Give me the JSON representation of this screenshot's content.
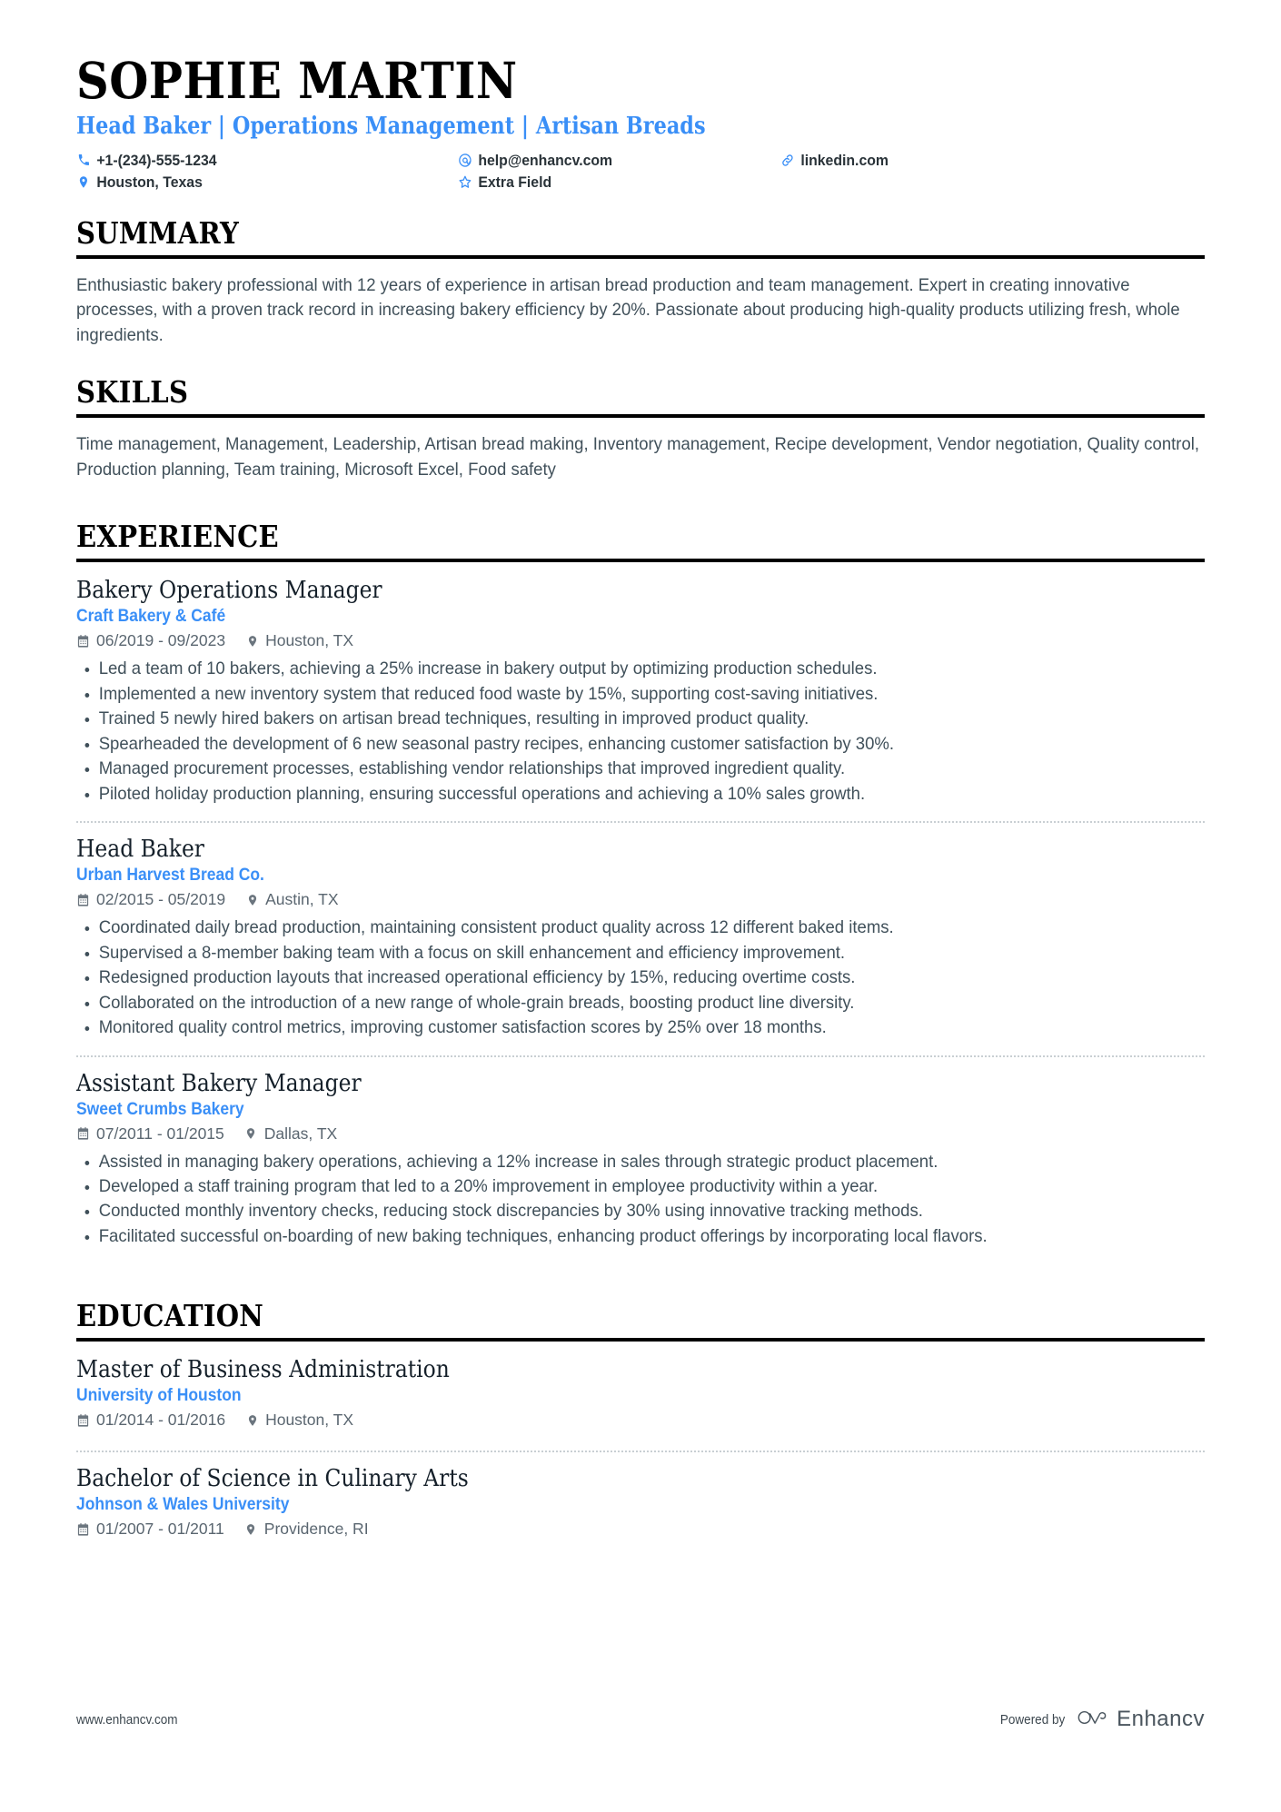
{
  "header": {
    "name": "SOPHIE MARTIN",
    "headline": "Head Baker | Operations Management | Artisan Breads",
    "contacts": [
      {
        "icon": "phone-icon",
        "text": "+1-(234)-555-1234"
      },
      {
        "icon": "email-icon",
        "text": "help@enhancv.com"
      },
      {
        "icon": "link-icon",
        "text": "linkedin.com"
      },
      {
        "icon": "location-icon",
        "text": "Houston, Texas"
      },
      {
        "icon": "star-icon",
        "text": "Extra Field"
      }
    ]
  },
  "summary": {
    "title": "SUMMARY",
    "text": "Enthusiastic bakery professional with 12 years of experience in artisan bread production and team management. Expert in creating innovative processes, with a proven track record in increasing bakery efficiency by 20%. Passionate about producing high-quality products utilizing fresh, whole ingredients."
  },
  "skills": {
    "title": "SKILLS",
    "text": "Time management, Management, Leadership, Artisan bread making, Inventory management, Recipe development, Vendor negotiation, Quality control, Production planning, Team training, Microsoft Excel, Food safety"
  },
  "experience": {
    "title": "EXPERIENCE",
    "entries": [
      {
        "title": "Bakery Operations Manager",
        "org": "Craft Bakery & Café",
        "dates": "06/2019 - 09/2023",
        "location": "Houston, TX",
        "bullets": [
          "Led a team of 10 bakers, achieving a 25% increase in bakery output by optimizing production schedules.",
          "Implemented a new inventory system that reduced food waste by 15%, supporting cost-saving initiatives.",
          "Trained 5 newly hired bakers on artisan bread techniques, resulting in improved product quality.",
          "Spearheaded the development of 6 new seasonal pastry recipes, enhancing customer satisfaction by 30%.",
          "Managed procurement processes, establishing vendor relationships that improved ingredient quality.",
          "Piloted holiday production planning, ensuring successful operations and achieving a 10% sales growth."
        ]
      },
      {
        "title": "Head Baker",
        "org": "Urban Harvest Bread Co.",
        "dates": "02/2015 - 05/2019",
        "location": "Austin, TX",
        "bullets": [
          "Coordinated daily bread production, maintaining consistent product quality across 12 different baked items.",
          "Supervised a 8-member baking team with a focus on skill enhancement and efficiency improvement.",
          "Redesigned production layouts that increased operational efficiency by 15%, reducing overtime costs.",
          "Collaborated on the introduction of a new range of whole-grain breads, boosting product line diversity.",
          "Monitored quality control metrics, improving customer satisfaction scores by 25% over 18 months."
        ]
      },
      {
        "title": "Assistant Bakery Manager",
        "org": "Sweet Crumbs Bakery",
        "dates": "07/2011 - 01/2015",
        "location": "Dallas, TX",
        "bullets": [
          "Assisted in managing bakery operations, achieving a 12% increase in sales through strategic product placement.",
          "Developed a staff training program that led to a 20% improvement in employee productivity within a year.",
          "Conducted monthly inventory checks, reducing stock discrepancies by 30% using innovative tracking methods.",
          "Facilitated successful on-boarding of new baking techniques, enhancing product offerings by incorporating local flavors."
        ]
      }
    ]
  },
  "education": {
    "title": "EDUCATION",
    "entries": [
      {
        "title": "Master of Business Administration",
        "org": "University of Houston",
        "dates": "01/2014 - 01/2016",
        "location": "Houston, TX"
      },
      {
        "title": "Bachelor of Science in Culinary Arts",
        "org": "Johnson & Wales University",
        "dates": "01/2007 - 01/2011",
        "location": "Providence, RI"
      }
    ]
  },
  "footer": {
    "url": "www.enhancv.com",
    "powered_by": "Powered by",
    "brand": "Enhancv"
  },
  "colors": {
    "accent": "#3a8ff7",
    "text": "#40505a",
    "heading": "#000000",
    "meta": "#5a6670"
  }
}
